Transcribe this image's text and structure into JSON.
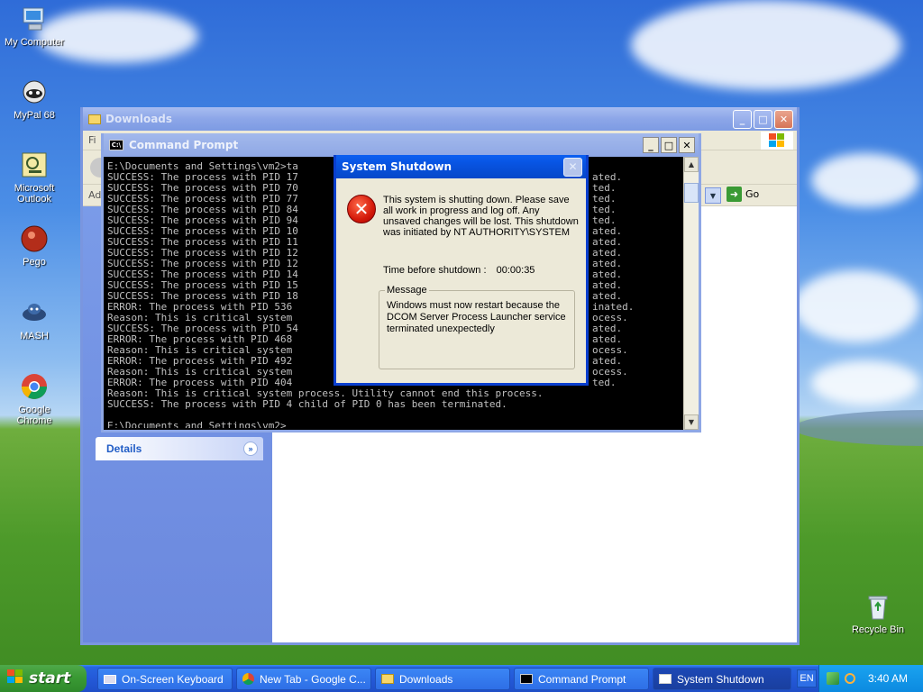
{
  "desktop": {
    "icons": [
      {
        "label": "My Computer",
        "icon": "computer-icon"
      },
      {
        "label": "MyPal 68",
        "icon": "mypal-icon"
      },
      {
        "label": "Microsoft Outlook",
        "icon": "outlook-icon"
      },
      {
        "label": "Pego",
        "icon": "pego-icon"
      },
      {
        "label": "MASH",
        "icon": "mash-icon"
      },
      {
        "label": "Google Chrome",
        "icon": "chrome-icon"
      },
      {
        "label": "Recycle Bin",
        "icon": "recycle-bin-icon"
      }
    ]
  },
  "explorer": {
    "title": "Downloads",
    "menu_partial": "Fi",
    "address_partial": "Ad",
    "go_label": "Go",
    "details_label": "Details"
  },
  "cmd": {
    "title": "Command Prompt",
    "lines": [
      "E:\\Documents and Settings\\vm2>ta",
      "SUCCESS: The process with PID 17",
      "SUCCESS: The process with PID 70",
      "SUCCESS: The process with PID 77",
      "SUCCESS: The process with PID 84",
      "SUCCESS: The process with PID 94",
      "SUCCESS: The process with PID 10",
      "SUCCESS: The process with PID 11",
      "SUCCESS: The process with PID 12",
      "SUCCESS: The process with PID 12",
      "SUCCESS: The process with PID 14",
      "SUCCESS: The process with PID 15",
      "SUCCESS: The process with PID 18",
      "ERROR: The process with PID 536",
      "Reason: This is critical system",
      "SUCCESS: The process with PID 54",
      "ERROR: The process with PID 468",
      "Reason: This is critical system",
      "ERROR: The process with PID 492",
      "Reason: This is critical system",
      "ERROR: The process with PID 404",
      "Reason: This is critical system process. Utility cannot end this process.",
      "SUCCESS: The process with PID 4 child of PID 0 has been terminated.",
      "",
      "E:\\Documents and Settings\\vm2>"
    ],
    "right_fragments": [
      "",
      "ated.",
      "ted.",
      "ted.",
      "ted.",
      "ted.",
      "ated.",
      "ated.",
      "ated.",
      "ated.",
      "ated.",
      "ated.",
      "ated.",
      "inated.",
      "ocess.",
      "ated.",
      "ated.",
      "ocess.",
      "ated.",
      "ocess.",
      "ted."
    ]
  },
  "shutdown": {
    "title": "System Shutdown",
    "warning": "This system is shutting down. Please save all work in progress and log off. Any unsaved changes will be lost. This shutdown was initiated by NT AUTHORITY\\SYSTEM",
    "time_label": "Time before shutdown :",
    "time_value": "00:00:35",
    "message_legend": "Message",
    "message_text": "Windows must now restart because the DCOM Server Process Launcher service terminated unexpectedly"
  },
  "taskbar": {
    "start_label": "start",
    "tasks": [
      {
        "label": "On-Screen Keyboard",
        "icon": "keyboard-icon"
      },
      {
        "label": "New Tab - Google C...",
        "icon": "chrome-icon"
      },
      {
        "label": "Downloads",
        "icon": "folder-icon"
      },
      {
        "label": "Command Prompt",
        "icon": "cmd-icon"
      },
      {
        "label": "System Shutdown",
        "icon": "window-icon"
      }
    ],
    "lang": "EN",
    "clock": "3:40 AM"
  }
}
